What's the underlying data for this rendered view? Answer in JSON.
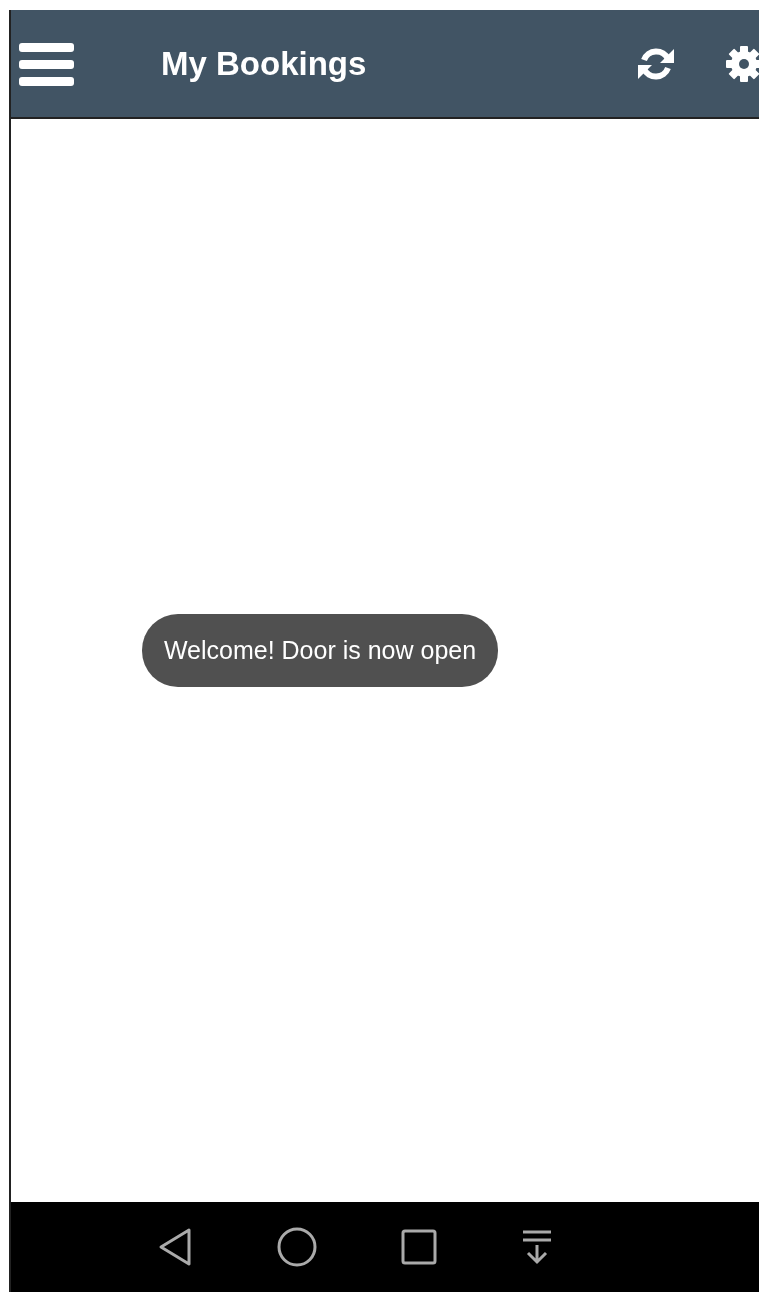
{
  "app_bar": {
    "title": "My Bookings"
  },
  "toast": {
    "text": "Welcome! Door is now open"
  }
}
